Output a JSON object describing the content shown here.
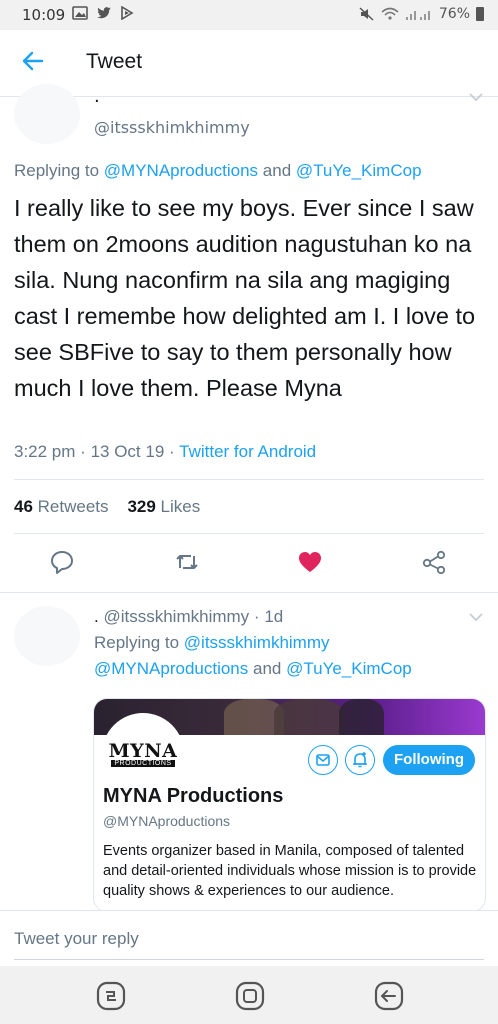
{
  "status_bar": {
    "time": "10:09",
    "battery": "76%"
  },
  "header": {
    "title": "Tweet"
  },
  "tweet": {
    "name": ".",
    "handle": "@itssskhimkhimmy",
    "replying_prefix": "Replying to",
    "replying_to_1": "@MYNAproductions",
    "and": "and",
    "replying_to_2": "@TuYe_KimCop",
    "text": "I really like to see my boys. Ever since I saw them on 2moons audition nagustuhan ko na sila. Nung naconfirm na sila ang magiging cast I remembe how delighted am I. I love to see SBFive to say to them personally how much I love them. Please Myna",
    "time": "3:22 pm",
    "sep": "·",
    "date": "13 Oct 19",
    "source": "Twitter for Android",
    "retweets_count": "46",
    "retweets_label": "Retweets",
    "likes_count": "329",
    "likes_label": "Likes"
  },
  "reply": {
    "name": ".",
    "handle": "@itssskhimkhimmy",
    "sep": "·",
    "age": "1d",
    "replying_prefix": "Replying to",
    "replying_to_1": "@itssskhimkhimmy",
    "replying_to_2": "@MYNAproductions",
    "and": "and",
    "replying_to_3": "@TuYe_KimCop",
    "card": {
      "logo_top": "MYNA",
      "logo_bottom": "PRODUCTIONS",
      "follow_label": "Following",
      "name": "MYNA Productions",
      "handle": "@MYNAproductions",
      "bio": "Events organizer based in Manila, composed of talented and detail-oriented individuals whose mission is to provide quality shows & experiences to our audience."
    }
  },
  "reply_box": {
    "placeholder": "Tweet your reply"
  },
  "colors": {
    "accent": "#1da1f2",
    "like": "#e0245e",
    "muted": "#657786"
  }
}
